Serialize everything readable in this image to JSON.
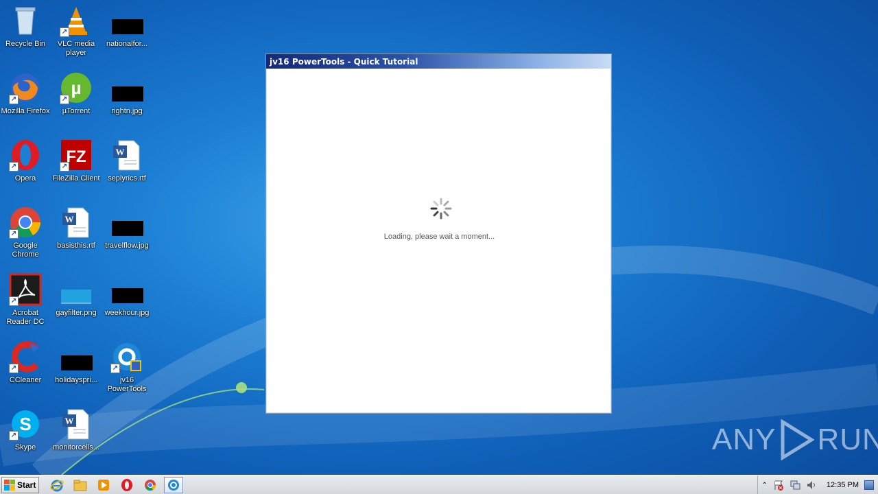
{
  "desktop_icons": [
    {
      "label": "Recycle Bin"
    },
    {
      "label": "VLC media player"
    },
    {
      "label": "nationalfor..."
    },
    {
      "label": "Mozilla Firefox"
    },
    {
      "label": "µTorrent"
    },
    {
      "label": "rightn.jpg"
    },
    {
      "label": "Opera"
    },
    {
      "label": "FileZilla Client"
    },
    {
      "label": "seplyrics.rtf"
    },
    {
      "label": "Google Chrome"
    },
    {
      "label": "basisthis.rtf"
    },
    {
      "label": "travelflow.jpg"
    },
    {
      "label": "Acrobat Reader DC"
    },
    {
      "label": "gayfilter.png"
    },
    {
      "label": "weekhour.jpg"
    },
    {
      "label": "CCleaner"
    },
    {
      "label": "holidayspri..."
    },
    {
      "label": "jv16 PowerTools"
    },
    {
      "label": "Skype"
    },
    {
      "label": "monitorcells..."
    }
  ],
  "dialog": {
    "title": "jv16 PowerTools - Quick Tutorial",
    "loading_text": "Loading, please wait a moment..."
  },
  "watermark": {
    "left": "ANY",
    "right": "RUN"
  },
  "taskbar": {
    "start_label": "Start",
    "clock": "12:35 PM"
  },
  "colors": {
    "desktop": "#1c7fd4",
    "title_gradient_start": "#14287a",
    "title_gradient_end": "#c8dcf4"
  }
}
